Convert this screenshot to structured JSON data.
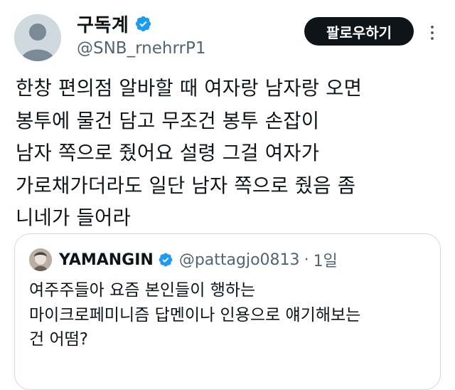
{
  "author": {
    "display_name": "구독계",
    "handle": "@SNB_rnehrrP1",
    "avatar_icon": "default-avatar-icon",
    "verified_icon": "verified-badge-icon"
  },
  "actions": {
    "follow_label": "팔로우하기",
    "more_icon": "more-options-icon"
  },
  "tweet": {
    "lines": [
      "한창 편의점 알바할 때 여자랑 남자랑 오면",
      "봉투에 물건 담고 무조건 봉투 손잡이",
      "남자 쪽으로 줬어요 설령 그걸 여자가",
      "가로채가더라도 일단 남자 쪽으로 줬음 좀",
      "니네가 들어라"
    ]
  },
  "quoted": {
    "display_name": "YAMANGIN",
    "handle": "@pattagjo0813",
    "separator": "·",
    "time": "1일",
    "lines": [
      "여주주들아 요즘 본인들이 행하는",
      "마이크로페미니즘 답멘이나 인용으로 얘기해보는",
      "건 어떰?"
    ]
  },
  "colors": {
    "text": "#0f1419",
    "secondary": "#536471",
    "verified": "#1d9bf0",
    "border": "#cfd9de",
    "button_bg": "#0f1419",
    "button_text": "#ffffff"
  }
}
